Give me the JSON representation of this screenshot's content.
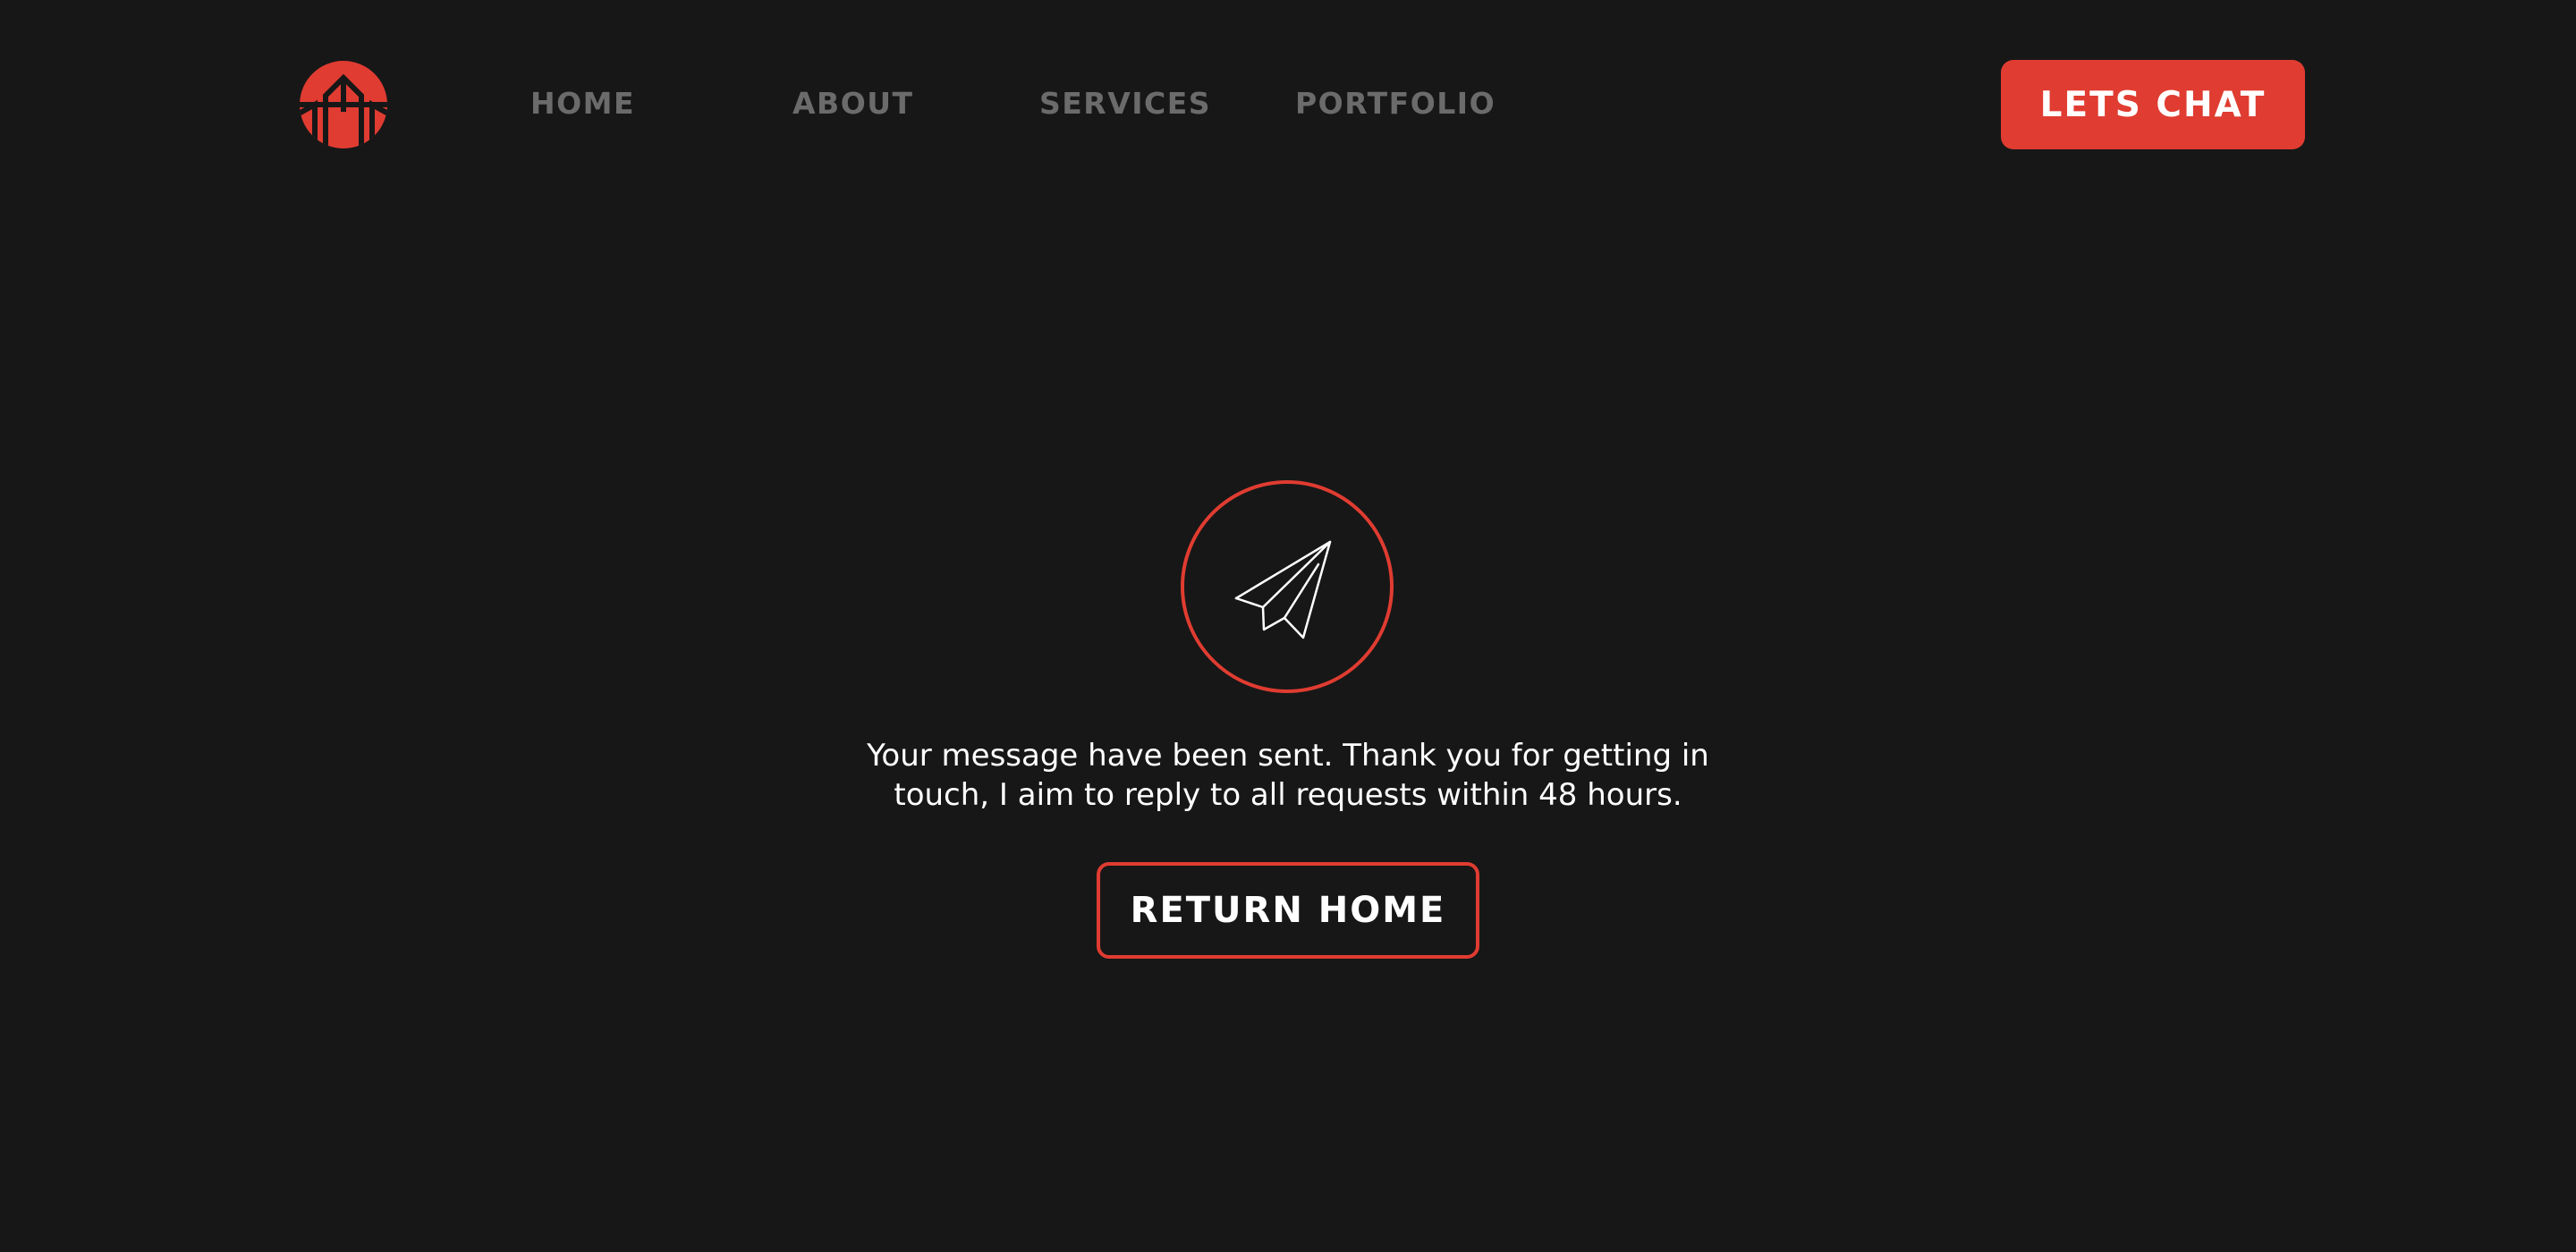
{
  "brand": {
    "logo_icon": "brand-logo-icon",
    "accent_color": "#e03c31",
    "background_color": "#171717"
  },
  "nav": {
    "items": [
      {
        "label": "HOME"
      },
      {
        "label": "ABOUT"
      },
      {
        "label": "SERVICES"
      },
      {
        "label": "PORTFOLIO"
      }
    ],
    "cta_label": "LETS CHAT"
  },
  "confirmation": {
    "icon": "paper-plane-icon",
    "message": "Your message have been sent. Thank you for getting in touch, I aim to reply to all requests within 48 hours.",
    "button_label": "RETURN HOME"
  }
}
